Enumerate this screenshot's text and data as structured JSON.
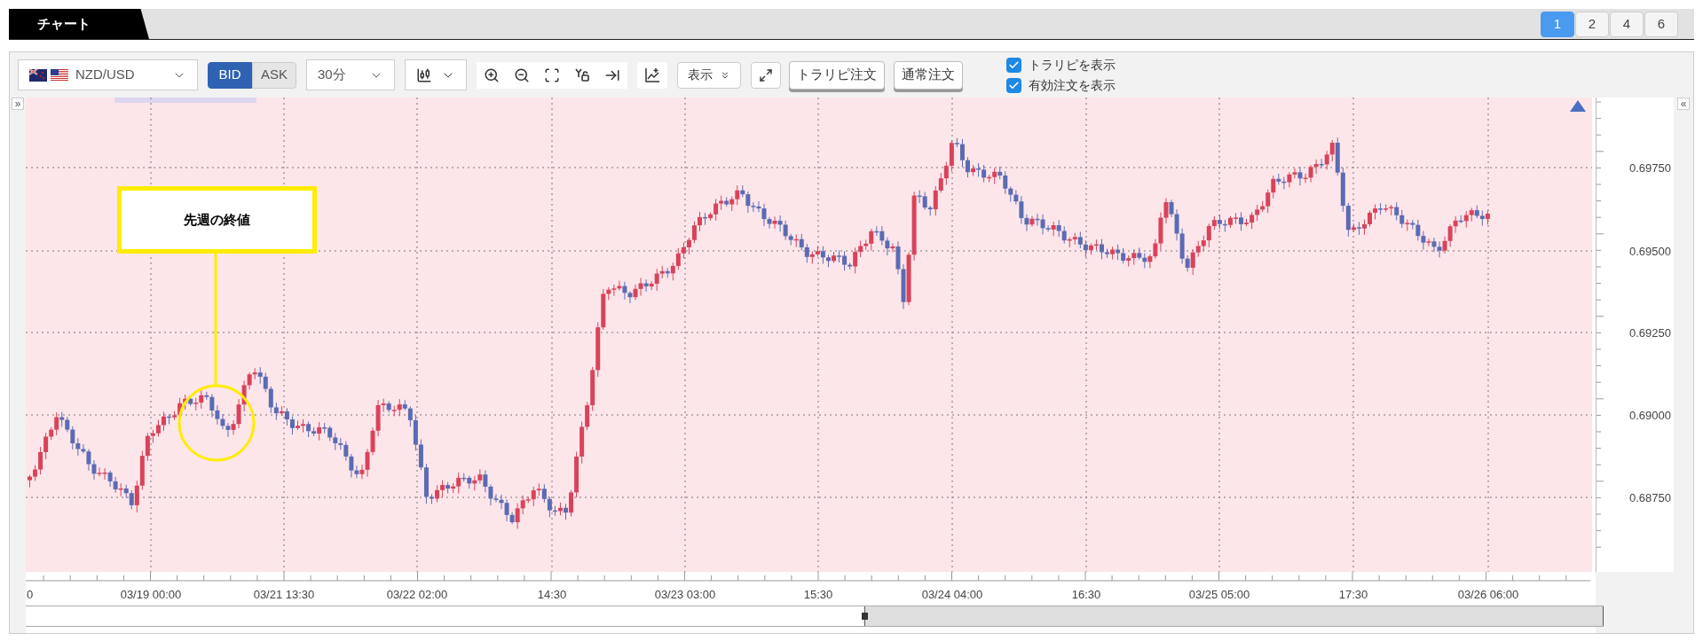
{
  "tabs": [
    {
      "label": "チャート",
      "selected": true
    }
  ],
  "layout_buttons": [
    {
      "label": "1",
      "selected": true
    },
    {
      "label": "2",
      "selected": false
    },
    {
      "label": "4",
      "selected": false
    },
    {
      "label": "6",
      "selected": false
    }
  ],
  "toolbar": {
    "currency_pair": "NZD/USD",
    "price_sides": [
      {
        "label": "BID",
        "selected": true
      },
      {
        "label": "ASK",
        "selected": false
      }
    ],
    "timeframe": "30分",
    "display_menu": "表示",
    "order_buttons": [
      "トラリピ注文",
      "通常注文"
    ],
    "options": [
      {
        "label": "トラリピを表示",
        "checked": true
      },
      {
        "label": "有効注文を表示",
        "checked": true
      }
    ]
  },
  "left_toggle": "»",
  "right_toggle": "«",
  "chart": {
    "y_labels": [
      "0.69750",
      "0.69500",
      "0.69250",
      "0.69000",
      "0.68750"
    ],
    "x_labels": [
      "0",
      "03/19 00:00",
      "03/21 13:30",
      "03/22 02:00",
      "14:30",
      "03/23 03:00",
      "15:30",
      "03/24 04:00",
      "16:30",
      "03/25 05:00",
      "17:30",
      "03/26 06:00"
    ],
    "annotation": "先週の終値"
  }
}
